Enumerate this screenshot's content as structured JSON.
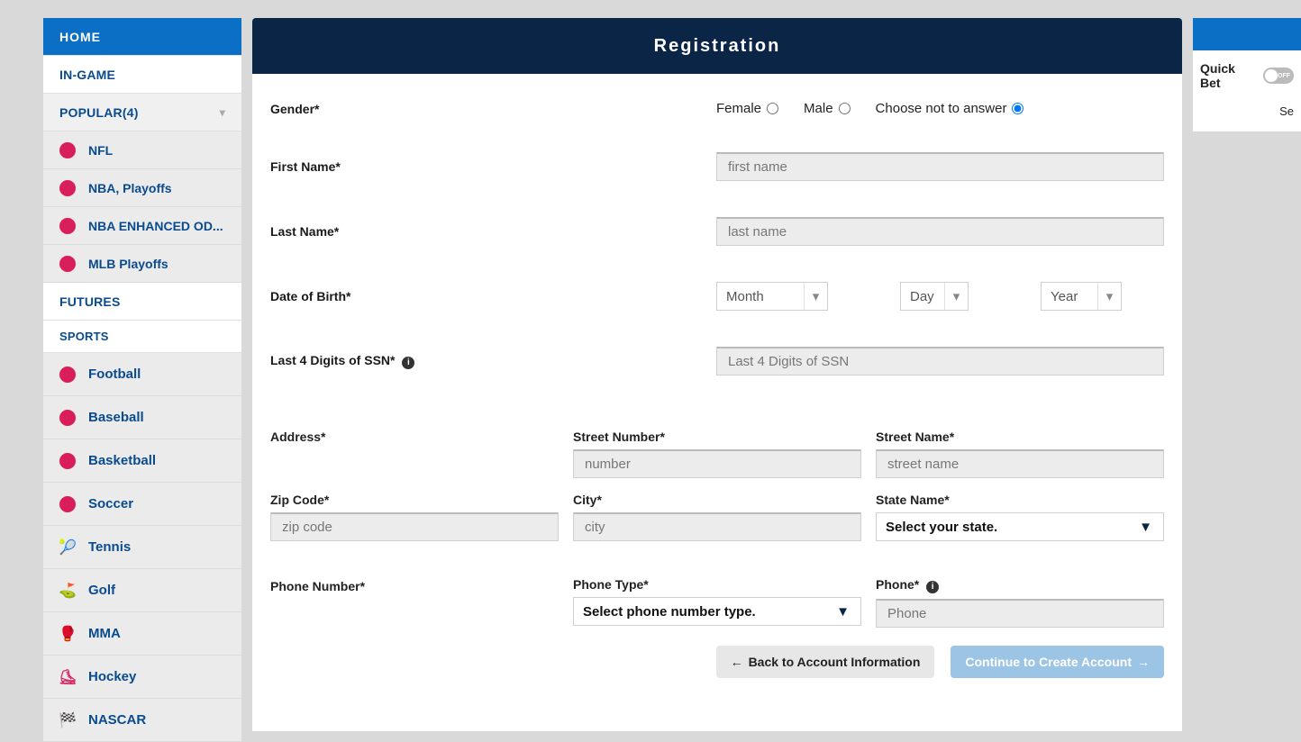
{
  "sidebar": {
    "home": "HOME",
    "in_game": "IN-GAME",
    "popular": "POPULAR(4)",
    "popular_items": [
      "NFL",
      "NBA, Playoffs",
      "NBA ENHANCED OD...",
      "MLB Playoffs"
    ],
    "futures": "FUTURES",
    "sports_header": "SPORTS",
    "sports": [
      "Football",
      "Baseball",
      "Basketball",
      "Soccer",
      "Tennis",
      "Golf",
      "MMA",
      "Hockey",
      "NASCAR"
    ]
  },
  "registration": {
    "title": "Registration",
    "gender_label": "Gender*",
    "gender_female": "Female",
    "gender_male": "Male",
    "gender_na": "Choose not to answer",
    "first_name_label": "First Name*",
    "first_name_ph": "first name",
    "last_name_label": "Last Name*",
    "last_name_ph": "last name",
    "dob_label": "Date of Birth*",
    "dob_month": "Month",
    "dob_day": "Day",
    "dob_year": "Year",
    "ssn_label": "Last 4 Digits of SSN*",
    "ssn_ph": "Last 4 Digits of SSN",
    "address_label": "Address*",
    "street_number_label": "Street Number*",
    "street_number_ph": "number",
    "street_name_label": "Street Name*",
    "street_name_ph": "street name",
    "zip_label": "Zip Code*",
    "zip_ph": "zip code",
    "city_label": "City*",
    "city_ph": "city",
    "state_label": "State Name*",
    "state_select": "Select your state.",
    "phone_number_label": "Phone Number*",
    "phone_type_label": "Phone Type*",
    "phone_type_select": "Select phone number type.",
    "phone_label": "Phone*",
    "phone_ph": "Phone",
    "btn_back": "Back to Account Information",
    "btn_continue": "Continue to Create Account"
  },
  "right": {
    "quick_bet": "Quick Bet",
    "toggle_state": "OFF",
    "secondary": "Se"
  }
}
